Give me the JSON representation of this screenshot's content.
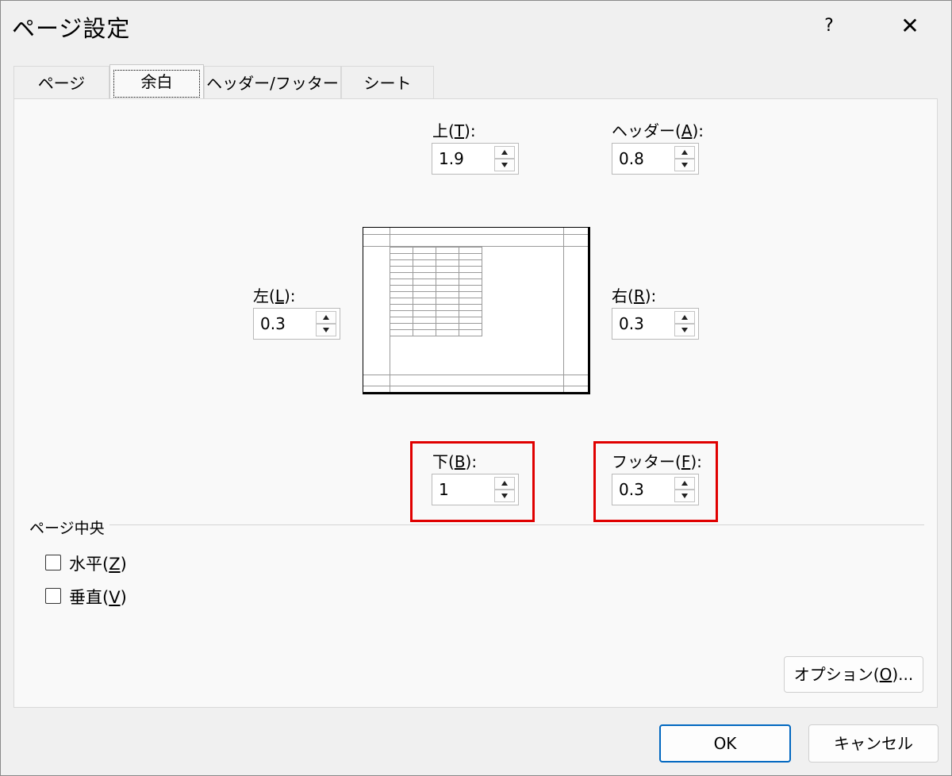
{
  "dialog": {
    "title": "ページ設定",
    "help": "?",
    "close": "✕"
  },
  "tabs": [
    {
      "label": "ページ"
    },
    {
      "label": "余白",
      "active": true
    },
    {
      "label": "ヘッダー/フッター"
    },
    {
      "label": "シート"
    }
  ],
  "margins": {
    "top": {
      "label_pre": "上(",
      "key": "T",
      "label_post": "):",
      "value": "1.9"
    },
    "header": {
      "label_pre": "ヘッダー(",
      "key": "A",
      "label_post": "):",
      "value": "0.8"
    },
    "left": {
      "label_pre": "左(",
      "key": "L",
      "label_post": "):",
      "value": "0.3"
    },
    "right": {
      "label_pre": "右(",
      "key": "R",
      "label_post": "):",
      "value": "0.3"
    },
    "bottom": {
      "label_pre": "下(",
      "key": "B",
      "label_post": "):",
      "value": "1"
    },
    "footer": {
      "label_pre": "フッター(",
      "key": "F",
      "label_post": "):",
      "value": "0.3"
    }
  },
  "center_on_page": {
    "legend": "ページ中央",
    "horizontal": {
      "label_pre": "水平(",
      "key": "Z",
      "label_post": ")",
      "checked": false
    },
    "vertical": {
      "label_pre": "垂直(",
      "key": "V",
      "label_post": ")",
      "checked": false
    }
  },
  "buttons": {
    "options": {
      "label_pre": "オプション(",
      "key": "O",
      "label_post": ")..."
    },
    "ok": "OK",
    "cancel": "キャンセル"
  },
  "colors": {
    "highlight": "#e00000",
    "primary_border": "#0067c0"
  }
}
